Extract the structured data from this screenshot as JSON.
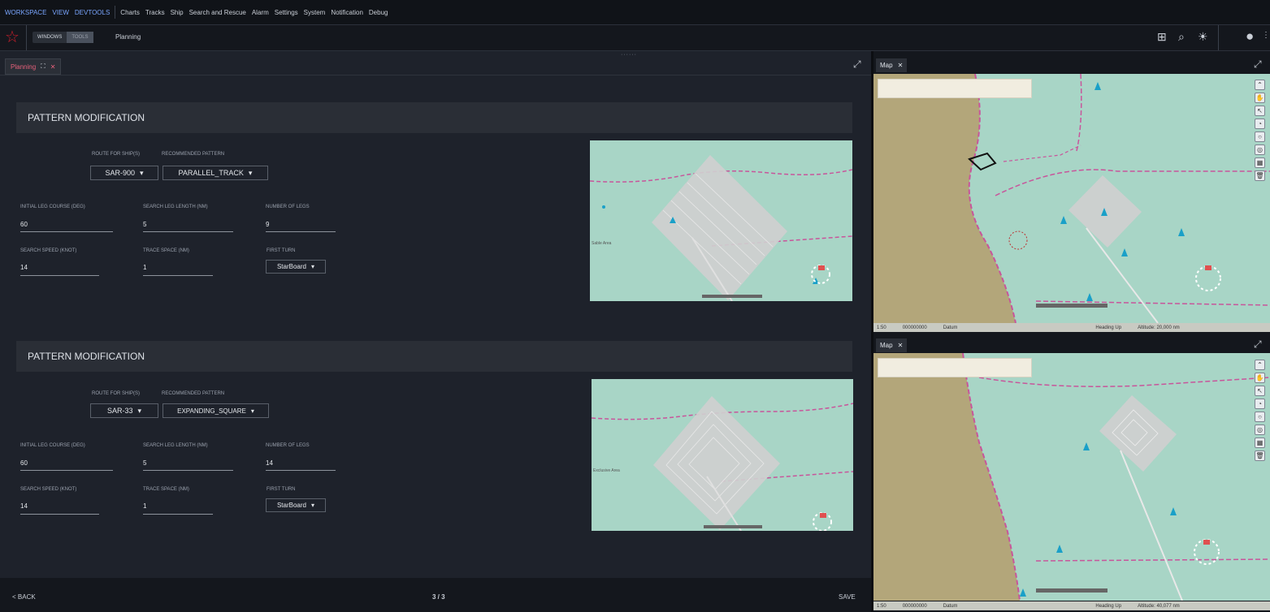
{
  "menubar": {
    "workspace_menu": [
      "WORKSPACE",
      "VIEW",
      "DEVTOOLS"
    ],
    "app_menu": [
      "Charts",
      "Tracks",
      "Ship",
      "Search and Rescue",
      "Alarm",
      "Settings",
      "System",
      "Notification",
      "Debug"
    ]
  },
  "toolbar": {
    "windows_label": "WINDOWS",
    "tools_label": "TOOLS",
    "breadcrumb": "Planning"
  },
  "planning_tab": {
    "label": "Planning"
  },
  "field_labels": {
    "route": "ROUTE FOR SHIP(S)",
    "pattern": "RECOMMENDED PATTERN",
    "initial_leg": "INITIAL LEG COURSE (DEG)",
    "search_leg": "SEARCH LEG LENGTH (NM)",
    "num_legs": "NUMBER OF LEGS",
    "speed": "SEARCH SPEED (KNOT)",
    "trace": "TRACE SPACE (NM)",
    "first_turn": "FIRST TURN"
  },
  "cards": [
    {
      "title": "PATTERN MODIFICATION",
      "route": "SAR-900",
      "pattern": "PARALLEL_TRACK",
      "initial_leg": "60",
      "search_leg": "5",
      "num_legs": "9",
      "speed": "14",
      "trace": "1",
      "first_turn": "StarBoard",
      "map_label": "Sable Area"
    },
    {
      "title": "PATTERN MODIFICATION",
      "route": "SAR-33",
      "pattern": "EXPANDING_SQUARE",
      "initial_leg": "60",
      "search_leg": "5",
      "num_legs": "14",
      "speed": "14",
      "trace": "1",
      "first_turn": "StarBoard",
      "map_label": "Exclusive Area"
    }
  ],
  "footer": {
    "back": "< BACK",
    "page": "3 / 3",
    "save": "SAVE"
  },
  "maps": [
    {
      "tab": "Map",
      "scale": "1:50",
      "coords": "000000000",
      "datum": "Datum",
      "heading": "Heading Up",
      "altitude": "Altitude: 20,000 nm"
    },
    {
      "tab": "Map",
      "scale": "1:50",
      "coords": "000000000",
      "datum": "Datum",
      "heading": "Heading Up",
      "altitude": "Altitude: 40,077 nm"
    }
  ],
  "colors": {
    "accent": "#7aa6ff",
    "brand_star": "#d0202c",
    "planning_tab_text": "#e6607a",
    "sea": "#a8d5c6",
    "land": "#b3a67a",
    "boundary": "#c8559b"
  }
}
